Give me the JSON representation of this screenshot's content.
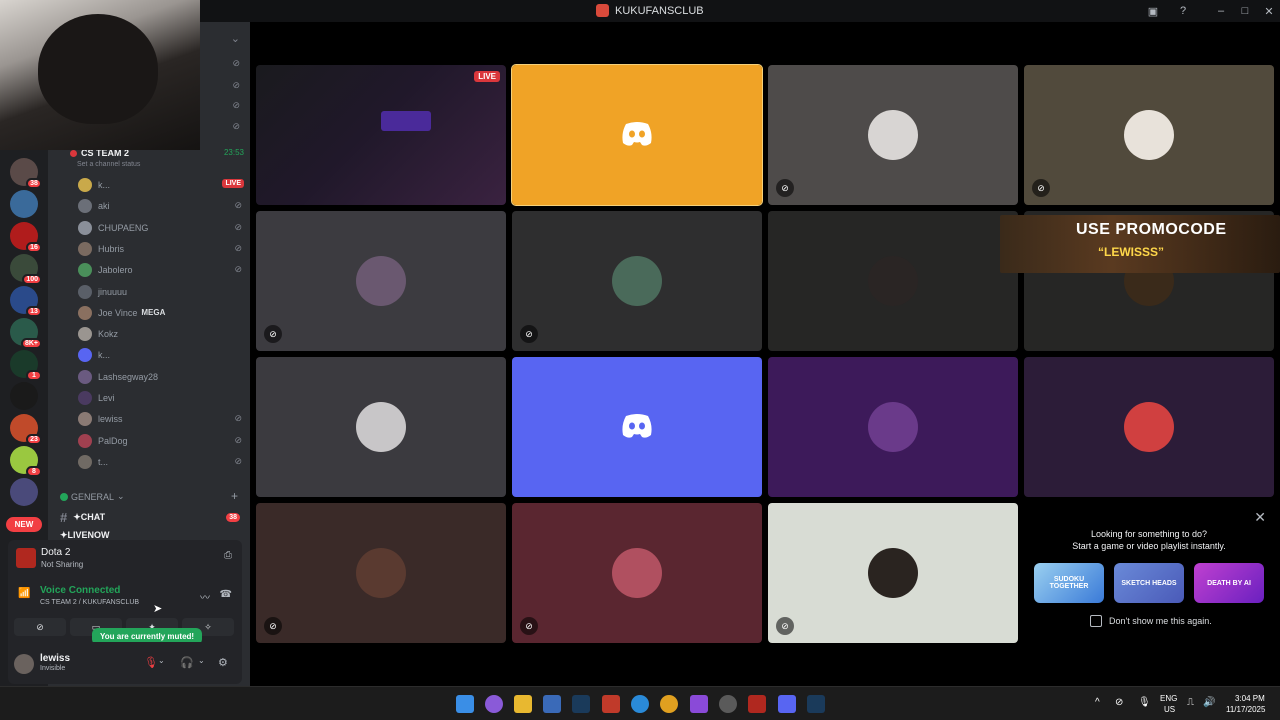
{
  "window": {
    "title": "KUKUFANSCLUB"
  },
  "rail": {
    "badges": [
      "38",
      "16",
      "100",
      "13",
      "8K+",
      "1",
      "23",
      "8"
    ],
    "new_label": "NEW"
  },
  "voice_channel": {
    "name": "CS TEAM 2",
    "timer": "23:53",
    "status_placeholder": "Set a channel status",
    "members": [
      {
        "name": "k...",
        "live": "LIVE",
        "color": "#c9a94a"
      },
      {
        "name": "aki",
        "color": "#6b6f78"
      },
      {
        "name": "CHUPAENG",
        "color": "#8a8f99"
      },
      {
        "name": "Hubris",
        "color": "#7a6a60"
      },
      {
        "name": "Jabolero",
        "color": "#4a8f5a"
      },
      {
        "name": "jinuuuu",
        "color": "#5a5f68"
      },
      {
        "name": "Joe Vince",
        "tag": "MEGA",
        "color": "#8a7060"
      },
      {
        "name": "Kokz",
        "color": "#9a9590"
      },
      {
        "name": "k...",
        "color": "#5865f2"
      },
      {
        "name": "Lashsegway28",
        "color": "#6a5a80"
      },
      {
        "name": "Levi",
        "color": "#4a3a60"
      },
      {
        "name": "lewiss",
        "color": "#8a7a74"
      },
      {
        "name": "PalDog",
        "color": "#a04050"
      },
      {
        "name": "t...",
        "color": "#706a64"
      }
    ]
  },
  "channels": {
    "category": "GENERAL",
    "chat": {
      "name": "✦CHAT",
      "badge": "38"
    },
    "livenow": "✦LIVENOW"
  },
  "activity": {
    "game": "Dota 2",
    "status": "Not Sharing"
  },
  "voice_panel": {
    "status": "Voice Connected",
    "location": "CS TEAM 2 / KUKUFANSCLUB",
    "tooltip": "You are currently muted!"
  },
  "user": {
    "name": "lewiss",
    "status": "Invisible"
  },
  "tiles": [
    {
      "kind": "stream",
      "live": "LIVE"
    },
    {
      "kind": "discord",
      "bg": "#f0a326"
    },
    {
      "kind": "avatar",
      "bg": "#4e4b4a",
      "av": "#d8d5d3",
      "muted": true
    },
    {
      "kind": "avatar",
      "bg": "#514a3c",
      "av": "#e8e2da",
      "muted": true
    },
    {
      "kind": "avatar",
      "bg": "#3c3b40",
      "av": "#6a5870",
      "muted": true
    },
    {
      "kind": "avatar",
      "bg": "#2e2e2f",
      "av": "#4a6a5a",
      "muted": true
    },
    {
      "kind": "avatar",
      "bg": "#262625",
      "av": "#2a2524",
      "muted": false
    },
    {
      "kind": "avatar",
      "bg": "#262625",
      "av": "#3a2a1a",
      "muted": false
    },
    {
      "kind": "avatar",
      "bg": "#3b3a3f",
      "av": "#c8c6c8",
      "muted": false
    },
    {
      "kind": "discord",
      "bg": "#5865f2"
    },
    {
      "kind": "avatar",
      "bg": "#3d1a5a",
      "av": "#6a3a8a",
      "muted": false
    },
    {
      "kind": "avatar",
      "bg": "#2c1c38",
      "av": "#d04040",
      "muted": false
    },
    {
      "kind": "avatar",
      "bg": "#3a2a28",
      "av": "#5a3a30",
      "muted": true
    },
    {
      "kind": "avatar",
      "bg": "#5a2630",
      "av": "#b05060",
      "muted": true
    },
    {
      "kind": "avatar",
      "bg": "#d8dcd4",
      "av": "#2a2420",
      "muted": true
    }
  ],
  "promo": {
    "line1": "USE PROMOCODE",
    "line2": "“LEWISSS”"
  },
  "suggestion": {
    "title": "Looking for something to do?",
    "subtitle": "Start a game or video playlist instantly.",
    "cards": [
      "SUDOKU TOGETHER",
      "SKETCH HEADS",
      "DEATH BY AI"
    ],
    "checkbox_label": "Don't show me this again."
  },
  "taskbar": {
    "lang1": "ENG",
    "lang2": "US",
    "time": "3:04 PM",
    "date": "11/17/2025"
  }
}
